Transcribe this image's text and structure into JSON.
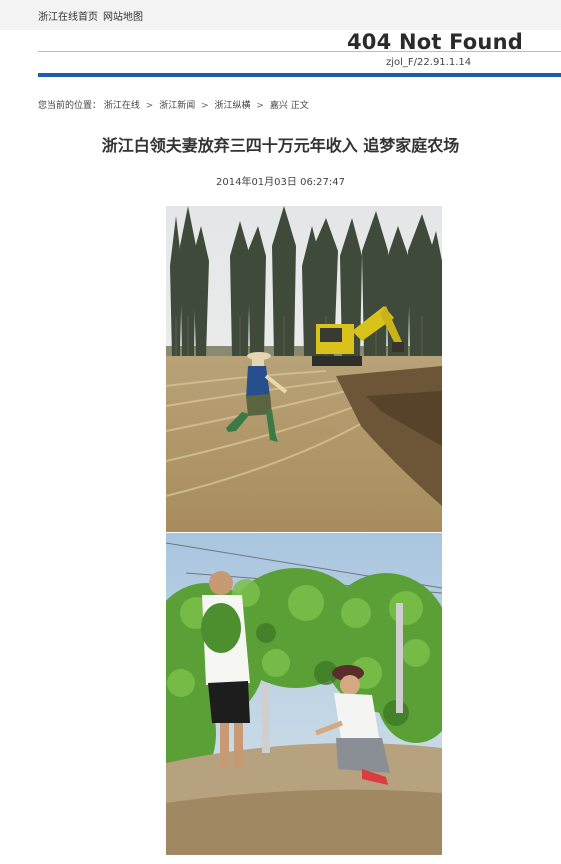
{
  "top_nav": {
    "home_label": "浙江在线首页",
    "sitemap_label": "网站地图"
  },
  "error": {
    "title": "404 Not Found",
    "code": "zjol_F/22.91.1.14"
  },
  "breadcrumb": {
    "prefix": "您当前的位置：",
    "items": [
      "浙江在线",
      "浙江新闻",
      "浙江纵横",
      "嘉兴"
    ],
    "current": "正文",
    "separator": ">"
  },
  "article": {
    "title": "浙江白领夫妻放弃三四十万元年收入 追梦家庭农场",
    "timestamp": "2014年01月03日 06:27:47"
  },
  "photos": [
    {
      "subject": "farm-field-excavator"
    },
    {
      "subject": "grape-vineyard-couple"
    }
  ]
}
